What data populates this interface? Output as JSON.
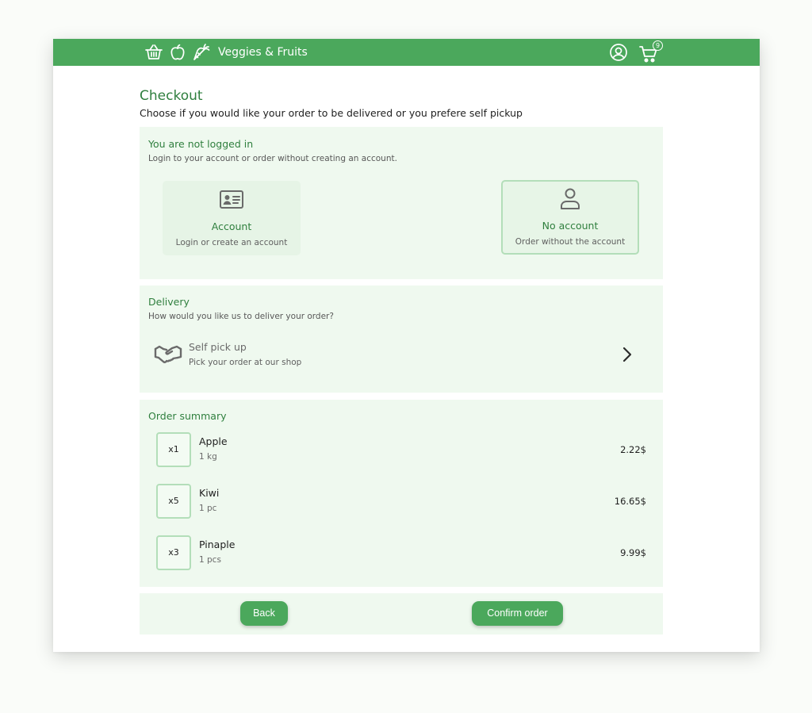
{
  "header": {
    "brand_name": "Veggies & Fruits",
    "brand_icons": [
      "basket-icon",
      "apple-icon",
      "carrot-icon"
    ],
    "user_icon": "user-circle-icon",
    "cart_icon": "cart-icon",
    "cart_count": "9",
    "bar_color": "#4ba85c"
  },
  "checkout": {
    "title": "Checkout",
    "subtitle": "Choose if you would like your order to be delivered or you prefere self pickup"
  },
  "login": {
    "title": "You are not logged in",
    "subtitle": "Login to your account or order without creating an account.",
    "options": [
      {
        "icon": "id-card-icon",
        "title": "Account",
        "desc": "Login or create an account",
        "selected": false
      },
      {
        "icon": "user-icon",
        "title": "No account",
        "desc": "Order without the account",
        "selected": true
      }
    ]
  },
  "delivery": {
    "title": "Delivery",
    "subtitle": "How would you like us to deliver your order?",
    "method": {
      "icon": "handshake-icon",
      "title": "Self pick up",
      "desc": "Pick your order at our shop"
    }
  },
  "summary": {
    "title": "Order summary",
    "items": [
      {
        "qty": "x1",
        "name": "Apple",
        "unit": "1 kg",
        "price": "2.22$"
      },
      {
        "qty": "x5",
        "name": "Kiwi",
        "unit": "1 pc",
        "price": "16.65$"
      },
      {
        "qty": "x3",
        "name": "Pinaple",
        "unit": "1 pcs",
        "price": "9.99$"
      }
    ]
  },
  "actions": {
    "back_label": "Back",
    "confirm_label": "Confirm order"
  },
  "colors": {
    "accent": "#4ba85c",
    "panel_bg": "#eff9ef",
    "heading_green": "#2f7f3e",
    "selected_border": "#b3deb9"
  }
}
